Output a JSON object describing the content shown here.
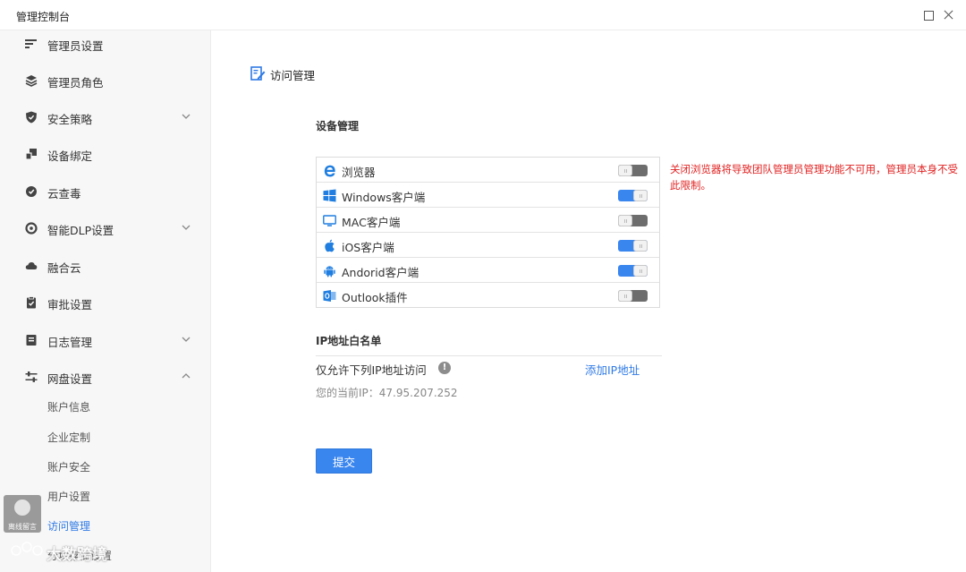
{
  "window": {
    "title": "管理控制台"
  },
  "sidebar": {
    "items": [
      {
        "label": "管理员设置",
        "icon": "list-icon"
      },
      {
        "label": "管理员角色",
        "icon": "layers-icon"
      },
      {
        "label": "安全策略",
        "icon": "shield-icon",
        "expandable": true
      },
      {
        "label": "设备绑定",
        "icon": "device-bind-icon"
      },
      {
        "label": "云查毒",
        "icon": "scan-icon"
      },
      {
        "label": "智能DLP设置",
        "icon": "dlp-gear-icon",
        "expandable": true
      },
      {
        "label": "融合云",
        "icon": "cloud-icon"
      },
      {
        "label": "审批设置",
        "icon": "clipboard-check-icon"
      },
      {
        "label": "日志管理",
        "icon": "log-icon",
        "expandable": true
      },
      {
        "label": "网盘设置",
        "icon": "sliders-icon",
        "expanded": true
      }
    ],
    "subitems": [
      {
        "label": "账户信息"
      },
      {
        "label": "企业定制"
      },
      {
        "label": "账户安全"
      },
      {
        "label": "用户设置"
      },
      {
        "label": "访问管理",
        "active": true
      }
    ],
    "partial_item": "分块存储设置"
  },
  "page": {
    "title": "访问管理"
  },
  "device_section": {
    "title": "设备管理",
    "devices": [
      {
        "label": "浏览器",
        "icon": "ie-browser-icon",
        "enabled": false
      },
      {
        "label": "Windows客户端",
        "icon": "windows-icon",
        "enabled": true
      },
      {
        "label": "MAC客户端",
        "icon": "monitor-icon",
        "enabled": false
      },
      {
        "label": "iOS客户端",
        "icon": "apple-icon",
        "enabled": true
      },
      {
        "label": "Andorid客户端",
        "icon": "android-icon",
        "enabled": true
      },
      {
        "label": "Outlook插件",
        "icon": "outlook-icon",
        "enabled": false
      }
    ],
    "warning": "关闭浏览器将导致团队管理员管理功能不可用，管理员本身不受此限制。"
  },
  "ip_section": {
    "title": "IP地址白名单",
    "allow_label": "仅允许下列IP地址访问",
    "info_glyph": "!",
    "add_link": "添加IP地址",
    "current_ip": "您的当前IP：47.95.207.252"
  },
  "actions": {
    "submit": "提交"
  },
  "widgets": {
    "support_caption": "离线留言",
    "watermark_text": "大数跨境"
  },
  "colors": {
    "accent": "#3a86ef",
    "warning": "#e02020",
    "sidebar_bg": "#f7f7f8"
  }
}
